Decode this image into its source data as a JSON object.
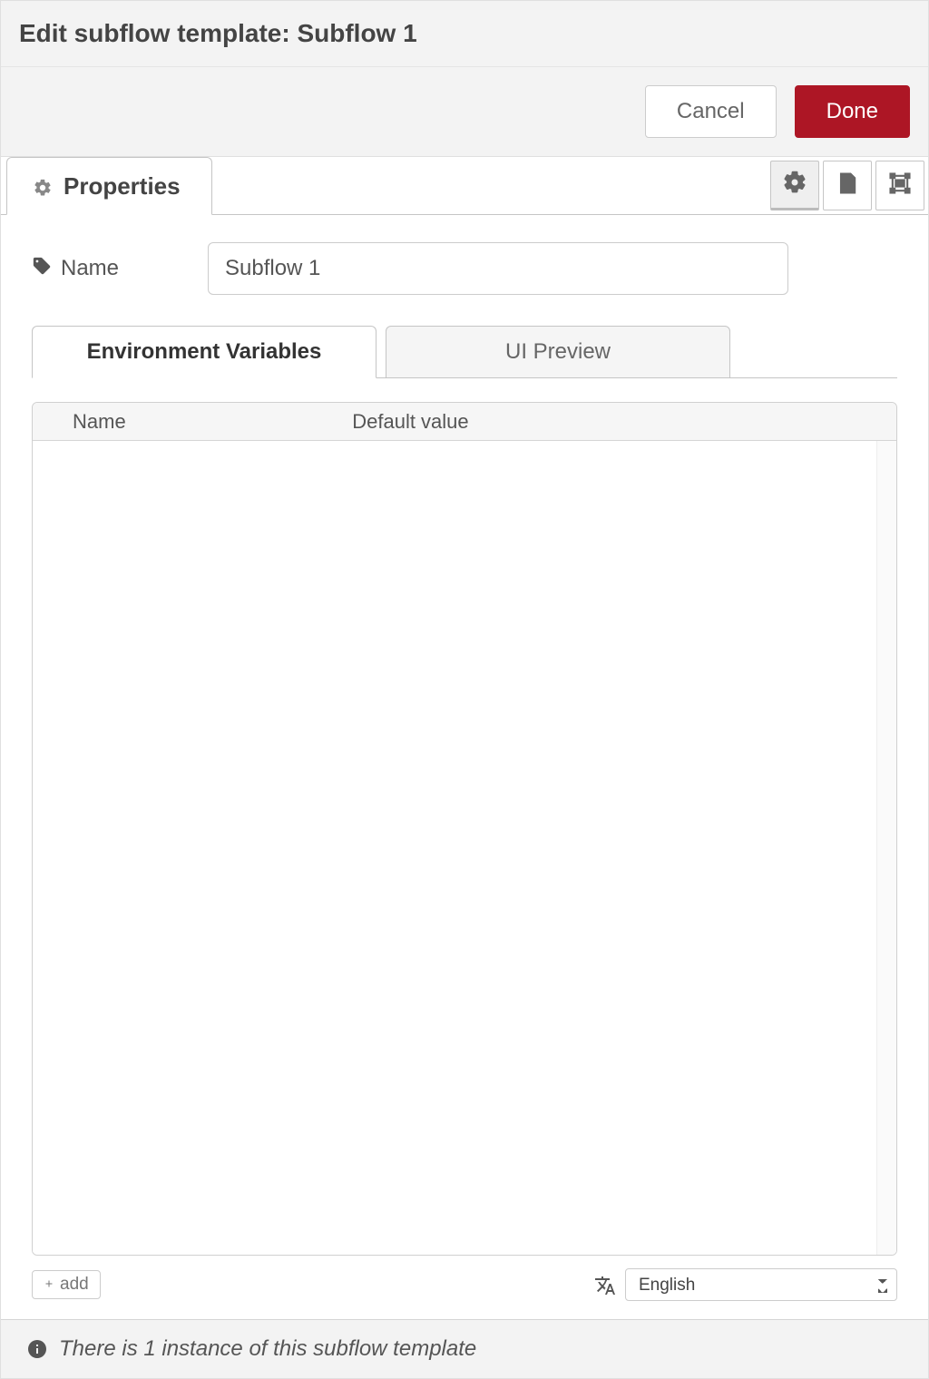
{
  "header": {
    "title": "Edit subflow template: Subflow 1"
  },
  "buttons": {
    "cancel": "Cancel",
    "done": "Done"
  },
  "tabs": {
    "main_label": "Properties"
  },
  "form": {
    "name_label": "Name",
    "name_value": "Subflow 1"
  },
  "inner_tabs": {
    "env": "Environment Variables",
    "preview": "UI Preview"
  },
  "grid": {
    "col_name": "Name",
    "col_default": "Default value"
  },
  "footer_controls": {
    "add_label": "add",
    "language_selected": "English"
  },
  "footer": {
    "instance_text": "There is 1 instance of this subflow template"
  }
}
